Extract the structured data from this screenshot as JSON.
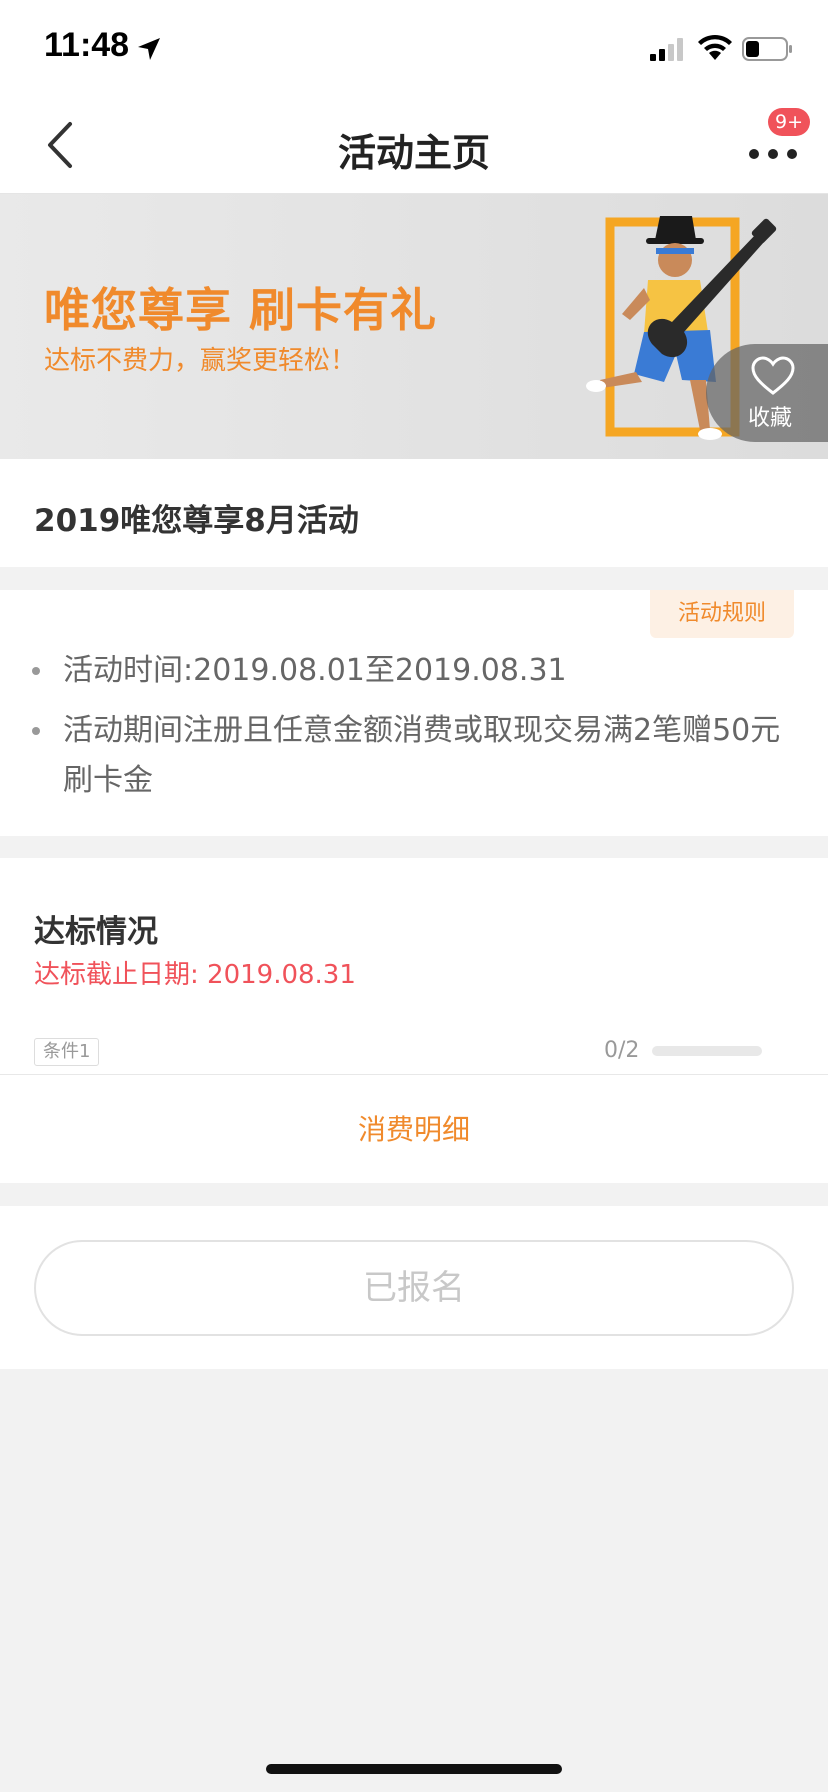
{
  "status_bar": {
    "time": "11:48"
  },
  "nav": {
    "title": "活动主页",
    "badge": "9+"
  },
  "banner": {
    "title": "唯您尊享 刷卡有礼",
    "subtitle": "达标不费力，赢奖更轻松！",
    "favorite_label": "收藏"
  },
  "activity": {
    "name": "2019唯您尊享8月活动"
  },
  "info": {
    "rules_label": "活动规则",
    "items": [
      "活动时间:2019.08.01至2019.08.31",
      "活动期间注册且任意金额消费或取现交易满2笔赠50元刷卡金"
    ]
  },
  "compliance": {
    "title": "达标情况",
    "deadline": "达标截止日期: 2019.08.31",
    "condition_tag": "条件1",
    "progress_text": "0/2",
    "progress_fraction": 0,
    "detail_link": "消费明细"
  },
  "register": {
    "button_label": "已报名"
  },
  "colors": {
    "accent": "#f08a2c",
    "alert": "#f0525a",
    "background": "#f2f2f2"
  }
}
